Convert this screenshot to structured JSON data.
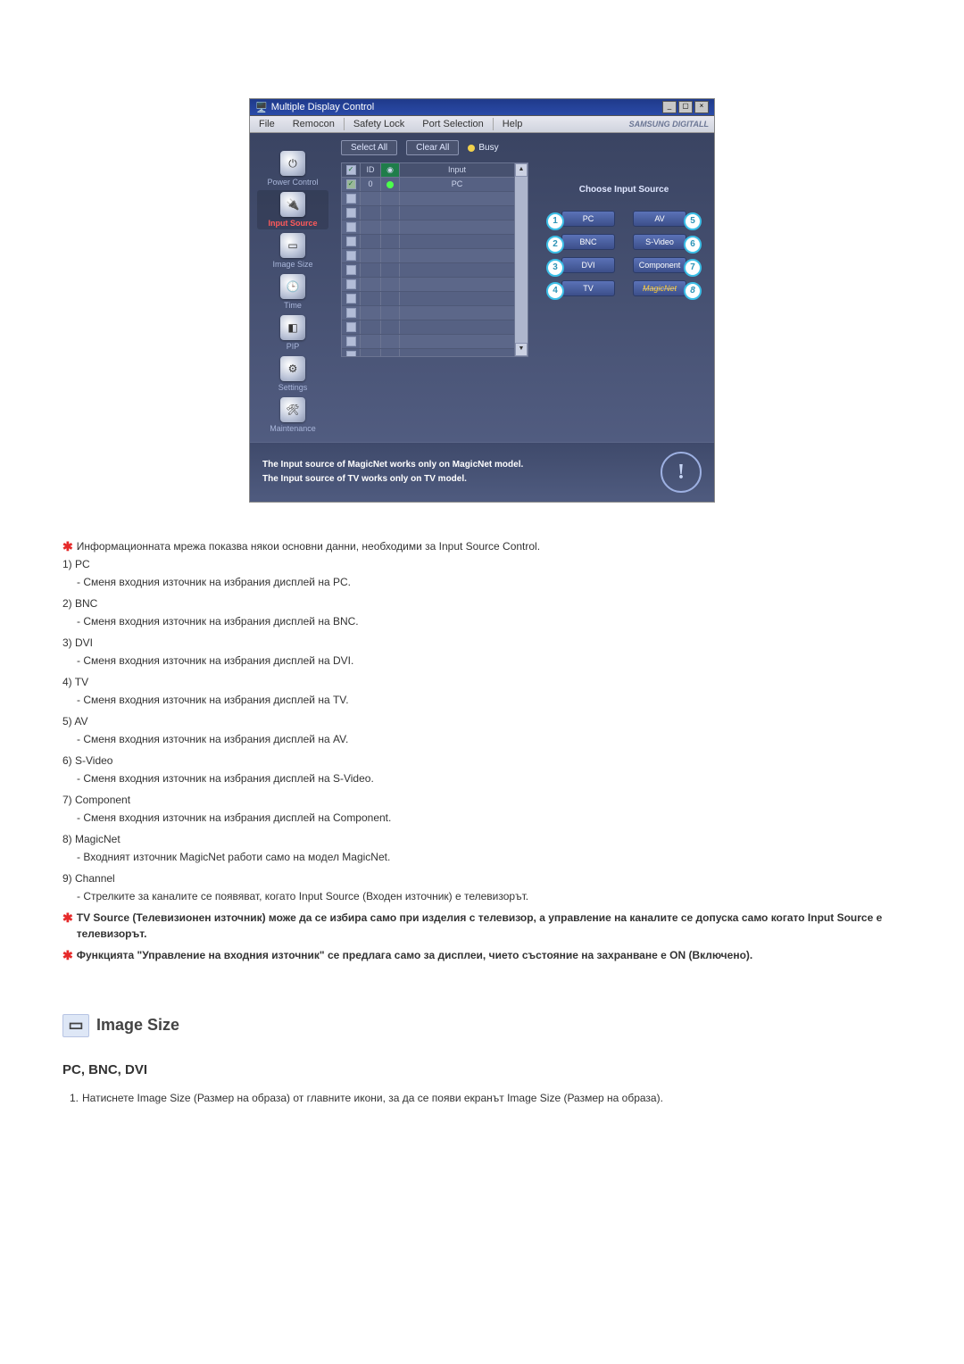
{
  "app": {
    "title": "Multiple Display Control",
    "menu": [
      "File",
      "Remocon",
      "Safety Lock",
      "Port Selection",
      "Help"
    ],
    "brand": "SAMSUNG DIGITALL",
    "sidebar": [
      {
        "label": "Power Control"
      },
      {
        "label": "Input Source",
        "active": true
      },
      {
        "label": "Image Size"
      },
      {
        "label": "Time"
      },
      {
        "label": "PIP"
      },
      {
        "label": "Settings"
      },
      {
        "label": "Maintenance"
      }
    ],
    "buttons": {
      "selectAll": "Select All",
      "clearAll": "Clear All",
      "busy": "Busy"
    },
    "grid": {
      "headers": {
        "id": "ID",
        "input": "Input"
      },
      "firstRow": {
        "id": "0",
        "input": "PC"
      }
    },
    "right": {
      "title": "Choose Input Source",
      "rows": [
        {
          "l": {
            "n": "1",
            "t": "PC"
          },
          "r": {
            "n": "5",
            "t": "AV"
          }
        },
        {
          "l": {
            "n": "2",
            "t": "BNC"
          },
          "r": {
            "n": "6",
            "t": "S-Video"
          }
        },
        {
          "l": {
            "n": "3",
            "t": "DVI"
          },
          "r": {
            "n": "7",
            "t": "Component"
          }
        },
        {
          "l": {
            "n": "4",
            "t": "TV"
          },
          "r": {
            "n": "8",
            "t": "MagicNet",
            "m": true
          }
        }
      ]
    },
    "footer": {
      "l1": "The Input source of MagicNet works only on MagicNet model.",
      "l2": "The Input source of TV works only on TV  model."
    }
  },
  "doc": {
    "intro": "Информационната мрежа показва някои основни данни, необходими за Input Source Control.",
    "items": [
      {
        "n": "1)",
        "h": "PC",
        "s": "- Сменя входния източник на избрания дисплей на PC."
      },
      {
        "n": "2)",
        "h": "BNC",
        "s": "- Сменя входния източник на избрания дисплей на BNC."
      },
      {
        "n": "3)",
        "h": "DVI",
        "s": "- Сменя входния източник на избрания дисплей на DVI."
      },
      {
        "n": "4)",
        "h": "TV",
        "s": "- Сменя входния източник на избрания дисплей на TV."
      },
      {
        "n": "5)",
        "h": "AV",
        "s": "- Сменя входния източник на избрания дисплей на AV."
      },
      {
        "n": "6)",
        "h": "S-Video",
        "s": "- Сменя входния източник на избрания дисплей на S-Video."
      },
      {
        "n": "7)",
        "h": "Component",
        "s": "- Сменя входния източник на избрания дисплей на Component."
      },
      {
        "n": "8)",
        "h": "MagicNet",
        "s": "- Входният източник MagicNet работи само на модел MagicNet."
      },
      {
        "n": "9)",
        "h": "Channel",
        "s": "- Стрелките за каналите се появяват, когато Input Source (Входен източник) е телевизорът."
      }
    ],
    "bold1": "TV Source (Телевизионен източник) може да се избира само при изделия с телевизор, а управление на каналите се допуска само когато Input Source е телевизорът.",
    "bold2": "Функцията \"Управление на входния източник\" се предлага само за дисплеи, чието състояние на захранване е ON (Включено).",
    "sectionTitle": "Image Size",
    "subTitle": "PC, BNC, DVI",
    "step1": "Натиснете Image Size (Размер на образа) от главните икони, за да се появи екранът Image Size (Размер на образа)."
  }
}
